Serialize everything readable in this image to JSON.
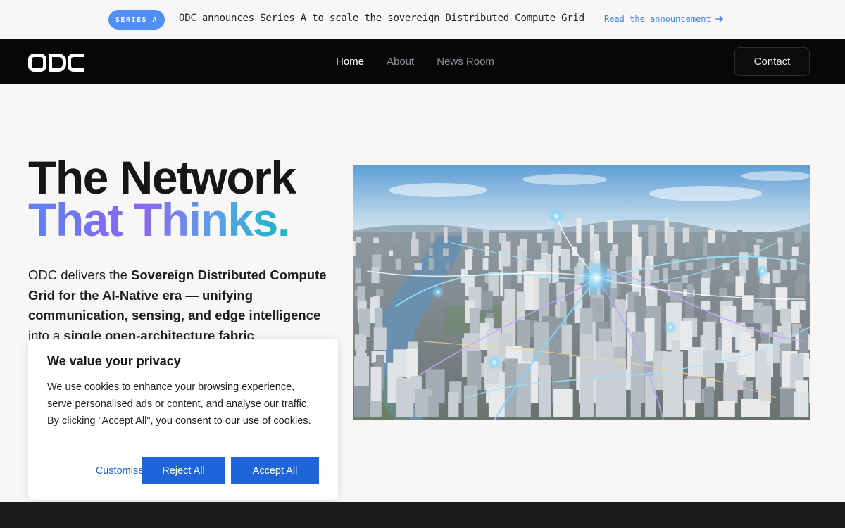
{
  "announcement": {
    "badge": "SERIES A",
    "message": "ODC announces Series A to scale the sovereign Distributed Compute Grid",
    "link_label": "Read the announcement",
    "link_icon": "arrow-right-icon",
    "badge_color": "#4f8ff7",
    "link_color": "#3f85ee"
  },
  "nav": {
    "logo": "ODC",
    "links": [
      {
        "label": "Home",
        "active": true
      },
      {
        "label": "About",
        "active": false
      },
      {
        "label": "News Room",
        "active": false
      }
    ],
    "contact": "Contact",
    "background": "#070708"
  },
  "hero": {
    "title_line1": "The Network",
    "title_line2": "That Thinks",
    "title_dot": ".",
    "desc_intro": "ODC delivers the ",
    "desc_bold1": "Sovereign Distributed Compute Grid for the AI-Native era — unifying communication, sensing, and edge intelligence",
    "desc_mid": " into a ",
    "desc_bold2": "single open-architecture fabric",
    "desc_end": ".",
    "image_alt": "Aerial view of a city with glowing network connections",
    "gradient_colors": [
      "#5b83f3",
      "#8b67f0",
      "#5ba0e8",
      "#24b3c9"
    ]
  },
  "cookie": {
    "title": "We value your privacy",
    "body": "We use cookies to enhance your browsing experience, serve personalised ads or content, and analyse our traffic. By clicking \"Accept All\", you consent to our use of cookies.",
    "customise": "Customise",
    "reject": "Reject All",
    "accept": "Accept All",
    "button_color": "#1e65d9"
  }
}
